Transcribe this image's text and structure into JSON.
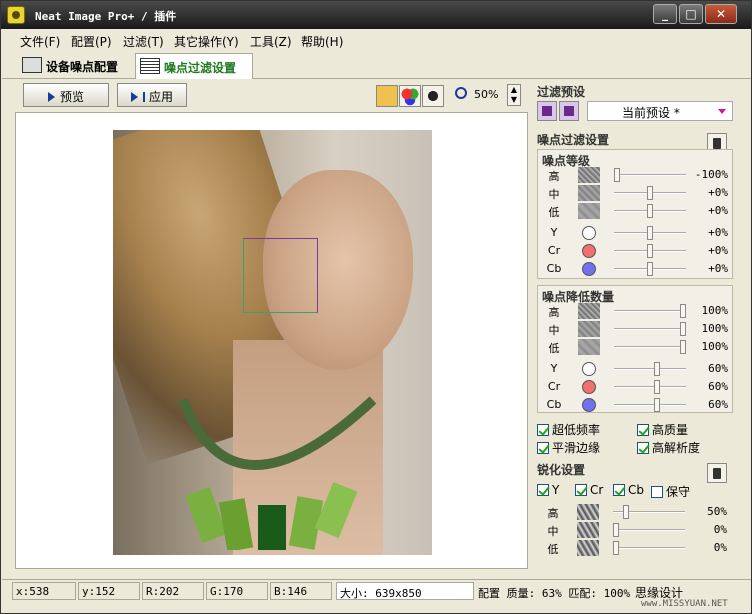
{
  "window": {
    "title": "Neat Image Pro+ / 插件"
  },
  "menu": [
    "文件(F)",
    "配置(P)",
    "过滤(T)",
    "其它操作(Y)",
    "工具(Z)",
    "帮助(H)"
  ],
  "tabs": [
    {
      "label": "设备噪点配置",
      "active": false
    },
    {
      "label": "噪点过滤设置",
      "active": true
    }
  ],
  "toolbar": {
    "preview_label": "预览",
    "apply_label": "应用",
    "zoom": "50%"
  },
  "filter_preset": {
    "title": "过滤预设",
    "current": "当前预设 *"
  },
  "noise_filter": {
    "title": "噪点过滤设置",
    "noise_level": {
      "title": "噪点等级",
      "rows": [
        {
          "label": "高",
          "value": "-100%",
          "level": 0
        },
        {
          "label": "中",
          "value": "+0%",
          "level": 0.5
        },
        {
          "label": "低",
          "value": "+0%",
          "level": 0.5
        },
        {
          "label": "Y",
          "value": "+0%",
          "level": 0.5,
          "color": "#ffffff"
        },
        {
          "label": "Cr",
          "value": "+0%",
          "level": 0.5,
          "color": "#f07070"
        },
        {
          "label": "Cb",
          "value": "+0%",
          "level": 0.5,
          "color": "#7070f0"
        }
      ]
    },
    "noise_reduction": {
      "title": "噪点降低数量",
      "rows": [
        {
          "label": "高",
          "value": "100%",
          "level": 1
        },
        {
          "label": "中",
          "value": "100%",
          "level": 1
        },
        {
          "label": "低",
          "value": "100%",
          "level": 1
        },
        {
          "label": "Y",
          "value": "60%",
          "level": 0.6,
          "color": "#ffffff"
        },
        {
          "label": "Cr",
          "value": "60%",
          "level": 0.6,
          "color": "#f07070"
        },
        {
          "label": "Cb",
          "value": "60%",
          "level": 0.6,
          "color": "#7070f0"
        }
      ]
    },
    "checkboxes": [
      {
        "label": "超低频率",
        "checked": true
      },
      {
        "label": "高质量",
        "checked": true
      },
      {
        "label": "平滑边缘",
        "checked": true
      },
      {
        "label": "高解析度",
        "checked": true
      }
    ]
  },
  "sharpen": {
    "title": "锐化设置",
    "checkboxes": [
      {
        "label": "Y",
        "checked": true
      },
      {
        "label": "Cr",
        "checked": true
      },
      {
        "label": "Cb",
        "checked": true
      },
      {
        "label": "保守",
        "checked": false
      }
    ],
    "rows": [
      {
        "label": "高",
        "value": "50%",
        "level": 0.15
      },
      {
        "label": "中",
        "value": "0%",
        "level": 0
      },
      {
        "label": "低",
        "value": "0%",
        "level": 0
      }
    ]
  },
  "status": {
    "x": "x:538",
    "y": "y:152",
    "r": "R:202",
    "g": "G:170",
    "b": "B:146",
    "size": "大小: 639x850",
    "profile": "配置 质量: 63%  匹配: 100%",
    "brand": "思缘设计",
    "watermark": "www.MISSYUAN.NET"
  }
}
